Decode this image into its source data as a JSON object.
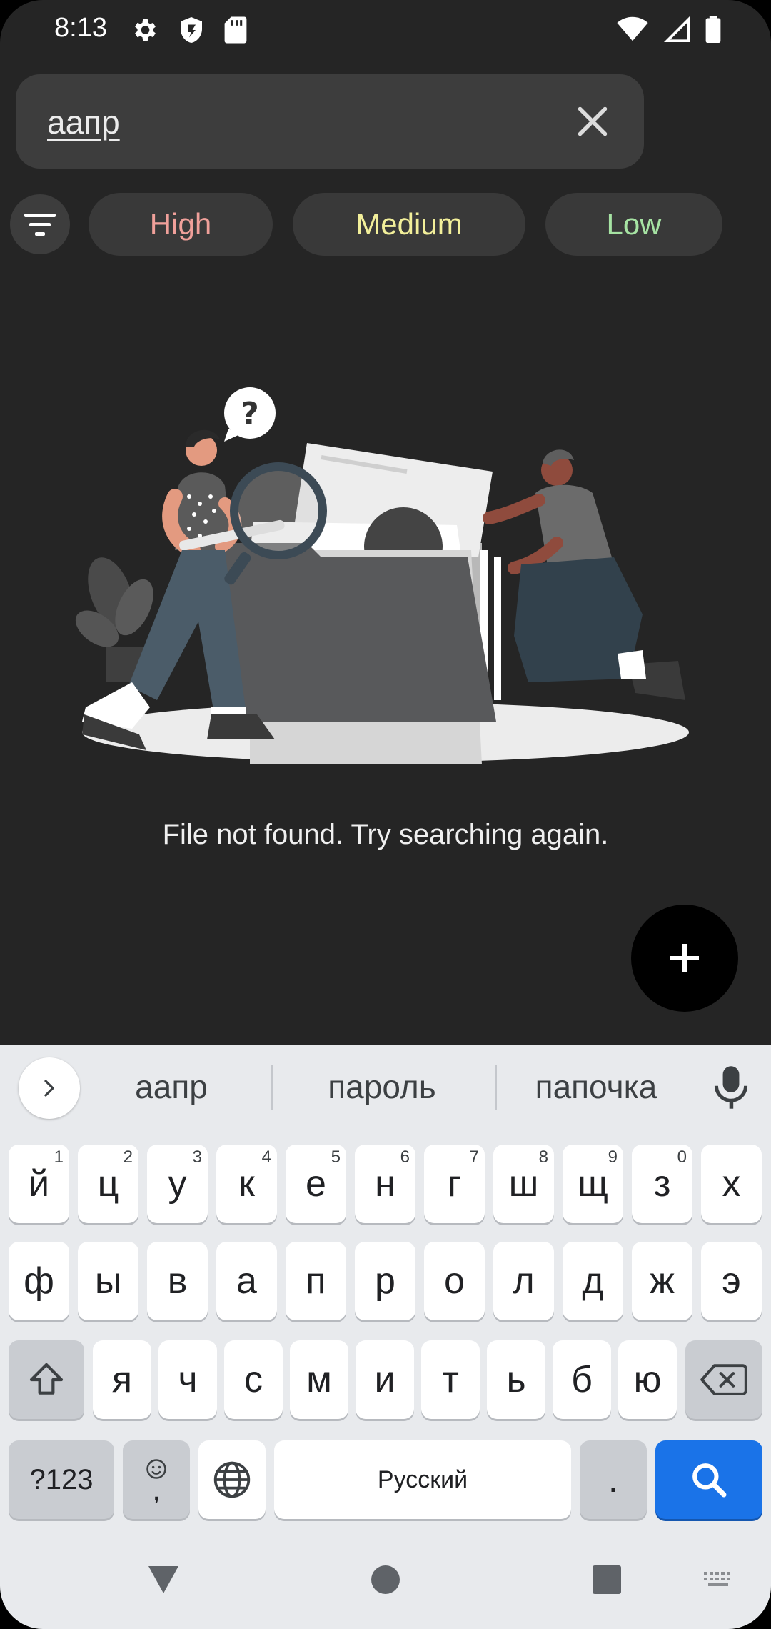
{
  "status_bar": {
    "time": "8:13",
    "left_icons": [
      "settings-icon",
      "shield-icon",
      "sd-card-icon"
    ],
    "right_icons": [
      "wifi-icon",
      "signal-icon",
      "battery-icon"
    ]
  },
  "search": {
    "query": "аапр",
    "clear_icon": "close-icon"
  },
  "filters": {
    "icon": "filter-icon",
    "chips": [
      {
        "label": "High",
        "color": "#f0a09a"
      },
      {
        "label": "Medium",
        "color": "#f2ef9a"
      },
      {
        "label": "Low",
        "color": "#a6e3a3"
      }
    ]
  },
  "empty_state": {
    "illustration": "file-search-illustration",
    "message": "File not found. Try searching again."
  },
  "fab": {
    "icon": "plus-icon"
  },
  "keyboard": {
    "suggestions": [
      "аапр",
      "пароль",
      "папочка"
    ],
    "row1": [
      {
        "key": "й",
        "hint": "1"
      },
      {
        "key": "ц",
        "hint": "2"
      },
      {
        "key": "у",
        "hint": "3"
      },
      {
        "key": "к",
        "hint": "4"
      },
      {
        "key": "е",
        "hint": "5"
      },
      {
        "key": "н",
        "hint": "6"
      },
      {
        "key": "г",
        "hint": "7"
      },
      {
        "key": "ш",
        "hint": "8"
      },
      {
        "key": "щ",
        "hint": "9"
      },
      {
        "key": "з",
        "hint": "0"
      },
      {
        "key": "х",
        "hint": ""
      }
    ],
    "row2": [
      "ф",
      "ы",
      "в",
      "а",
      "п",
      "р",
      "о",
      "л",
      "д",
      "ж",
      "э"
    ],
    "row3": [
      "я",
      "ч",
      "с",
      "м",
      "и",
      "т",
      "ь",
      "б",
      "ю"
    ],
    "row4": {
      "symbols": "?123",
      "comma": ",",
      "space": "Русский",
      "period": "."
    },
    "accent_color": "#1a73e8"
  },
  "nav_bar": {
    "icons": [
      "back-icon",
      "home-icon",
      "recents-icon",
      "keyboard-switch-icon"
    ]
  }
}
